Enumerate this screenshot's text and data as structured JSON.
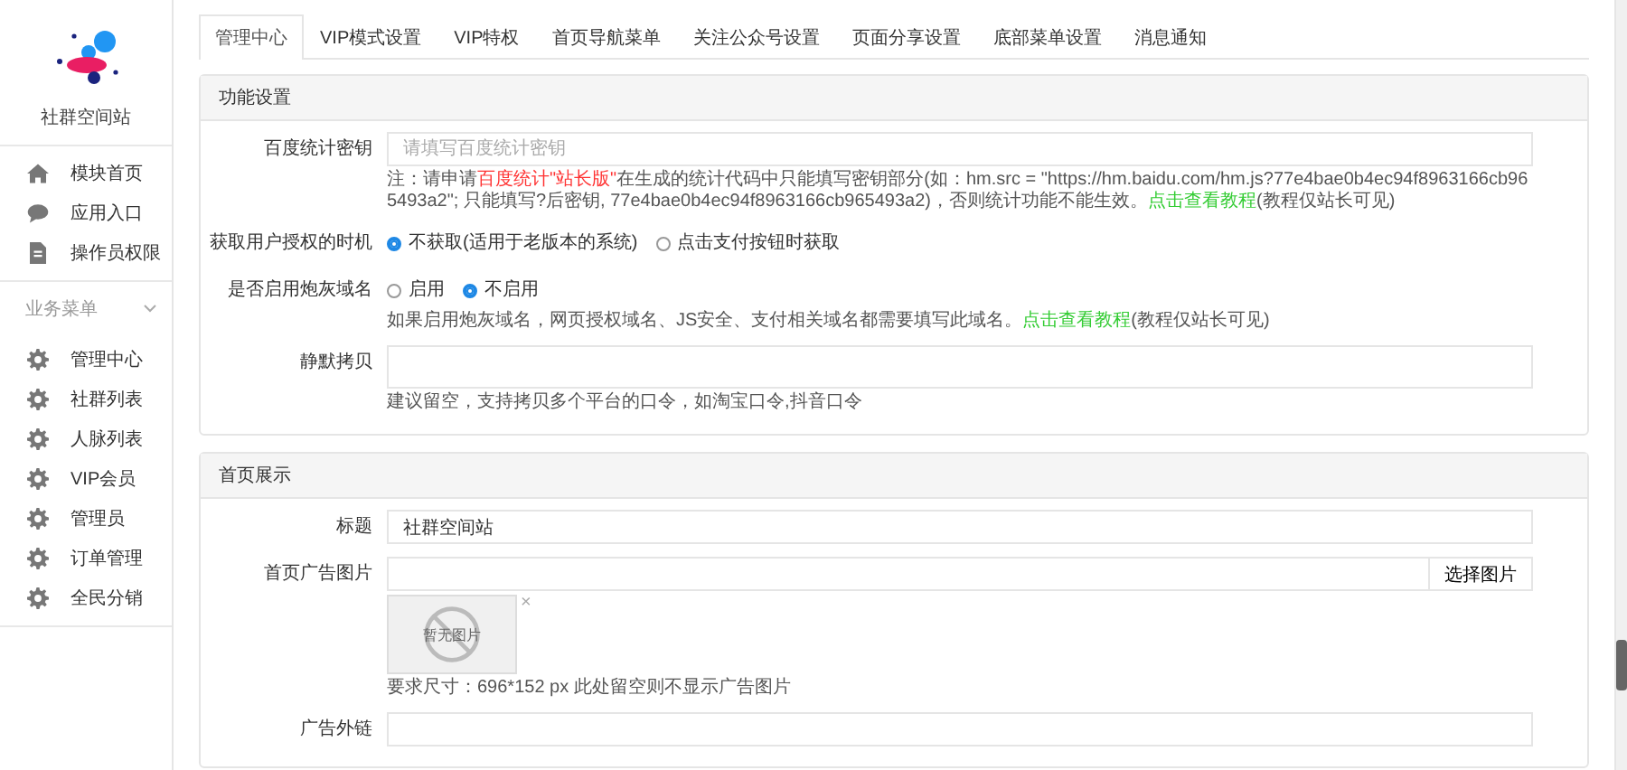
{
  "sidebar": {
    "site_name": "社群空间站",
    "top_items": [
      {
        "label": "模块首页"
      },
      {
        "label": "应用入口"
      },
      {
        "label": "操作员权限"
      }
    ],
    "section": {
      "title": "业务菜单",
      "expanded": true
    },
    "items": [
      {
        "label": "管理中心"
      },
      {
        "label": "社群列表"
      },
      {
        "label": "人脉列表"
      },
      {
        "label": "VIP会员"
      },
      {
        "label": "管理员"
      },
      {
        "label": "订单管理"
      },
      {
        "label": "全民分销"
      }
    ]
  },
  "tabs": [
    {
      "label": "管理中心",
      "selected": true
    },
    {
      "label": "VIP模式设置",
      "selected": false
    },
    {
      "label": "VIP特权",
      "selected": false
    },
    {
      "label": "首页导航菜单",
      "selected": false
    },
    {
      "label": "关注公众号设置",
      "selected": false
    },
    {
      "label": "页面分享设置",
      "selected": false
    },
    {
      "label": "底部菜单设置",
      "selected": false
    },
    {
      "label": "消息通知",
      "selected": false
    }
  ],
  "panels": [
    {
      "title": "功能设置",
      "fields": [
        {
          "kind": "text",
          "label": "百度统计密钥",
          "placeholder": "请填写百度统计密钥",
          "help": [
            {
              "kind": "text",
              "text": "注：请申请"
            },
            {
              "kind": "highlight",
              "text": "百度统计\"站长版\""
            },
            {
              "kind": "text",
              "text": "在生成的统计代码中只能填写密钥部分(如：hm.src = \"https://hm.baidu.com/hm.js?77e4bae0b4ec94f8963166cb965493a2\"; 只能填写?后密钥, 77e4bae0b4ec94f8963166cb965493a2)，否则统计功能不能生效。"
            },
            {
              "kind": "link",
              "text": "点击查看教程"
            },
            {
              "kind": "text",
              "text": "(教程仅站长可见)"
            }
          ]
        },
        {
          "kind": "radio",
          "label": "获取用户授权的时机",
          "options": [
            {
              "label": "不获取(适用于老版本的系统)",
              "selected": true
            },
            {
              "label": "点击支付按钮时获取",
              "selected": false
            }
          ]
        },
        {
          "kind": "radio",
          "label": "是否启用炮灰域名",
          "options": [
            {
              "label": "启用",
              "selected": false
            },
            {
              "label": "不启用",
              "selected": true
            }
          ],
          "help": [
            {
              "kind": "text",
              "text": "如果启用炮灰域名，网页授权域名、JS安全、支付相关域名都需要填写此域名。"
            },
            {
              "kind": "link",
              "text": "点击查看教程"
            },
            {
              "kind": "text",
              "text": "(教程仅站长可见)"
            }
          ]
        },
        {
          "kind": "textarea",
          "label": "静默拷贝",
          "help": [
            {
              "kind": "text",
              "text": "建议留空，支持拷贝多个平台的口令，如淘宝口令,抖音口令"
            }
          ]
        }
      ]
    },
    {
      "title": "首页展示",
      "fields": [
        {
          "kind": "text",
          "label": "标题",
          "value": "社群空间站"
        },
        {
          "kind": "image",
          "label": "首页广告图片",
          "button": "选择图片",
          "remove": "×",
          "empty_image": "暂无图片",
          "help": [
            {
              "kind": "text",
              "text": "要求尺寸：696*152 px 此处留空则不显示广告图片"
            }
          ]
        },
        {
          "kind": "text",
          "label": "广告外链"
        }
      ]
    }
  ]
}
